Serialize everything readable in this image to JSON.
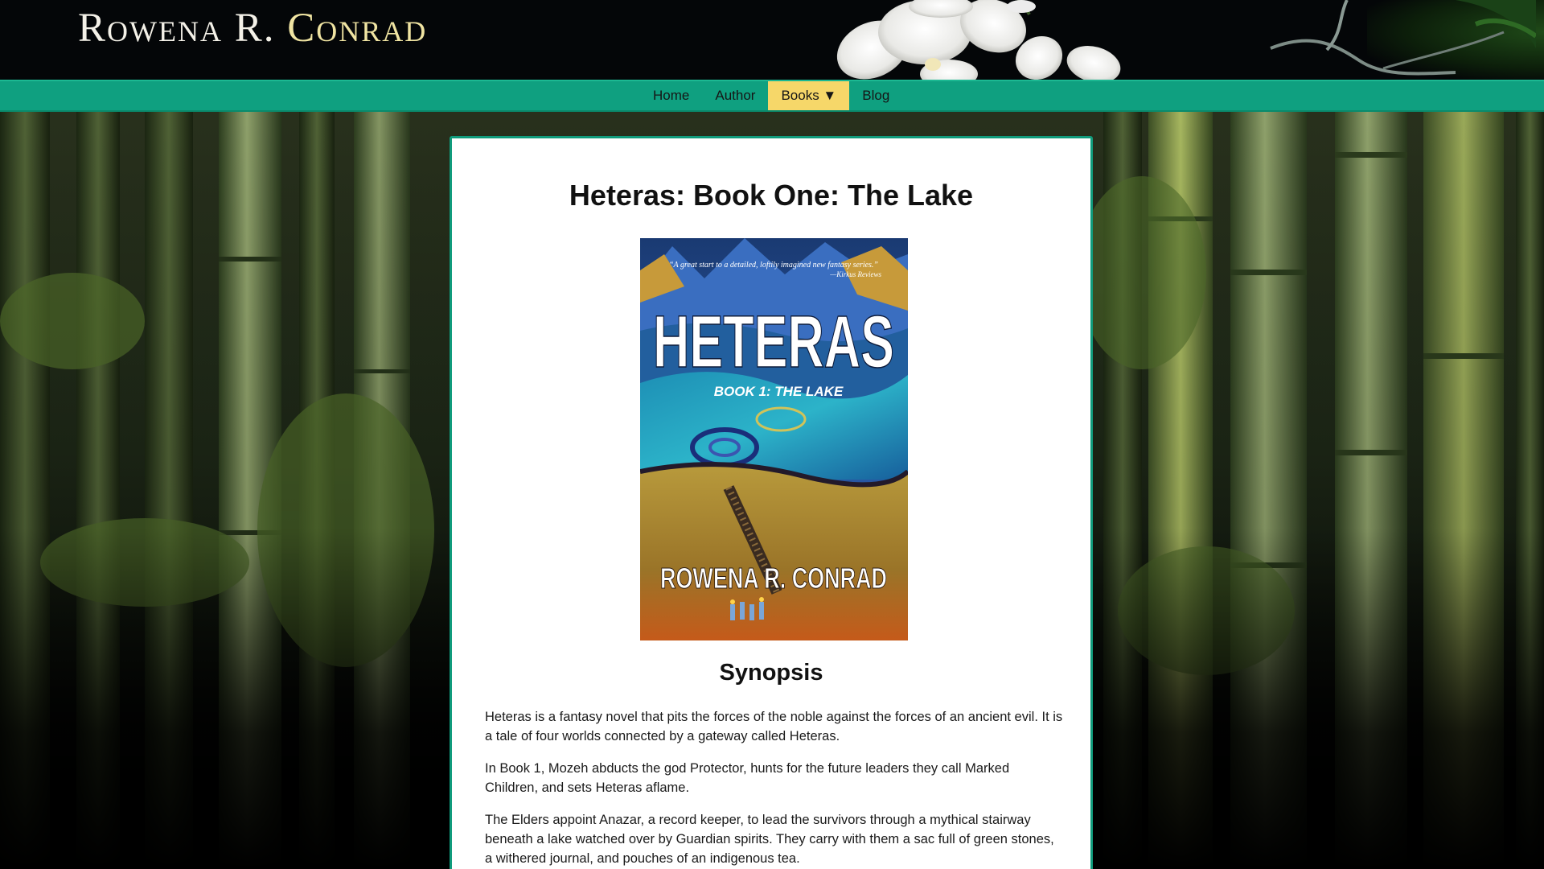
{
  "header": {
    "title_first": "Rowena R.",
    "title_last": "Conrad"
  },
  "nav": {
    "items": [
      {
        "label": "Home",
        "active": false
      },
      {
        "label": "Author",
        "active": false
      },
      {
        "label": "Books ▼",
        "active": true
      },
      {
        "label": "Blog",
        "active": false
      }
    ]
  },
  "page": {
    "title": "Heteras: Book One: The Lake",
    "cover": {
      "quote": "“A great start to a detailed, loftily imagined new fantasy series.”",
      "quote_source": "—Kirkus Reviews",
      "series": "HETERAS",
      "subtitle": "BOOK 1: THE LAKE",
      "author": "ROWENA R. CONRAD"
    },
    "synopsis_heading": "Synopsis",
    "paragraphs": [
      "Heteras is a fantasy novel that pits the forces of the noble against the forces of an ancient evil. It is a tale of four worlds connected by a gateway called Heteras.",
      "In Book 1, Mozeh abducts the god Protector, hunts for the future leaders they call Marked Children, and sets Heteras aflame.",
      "The Elders appoint Anazar, a record keeper, to lead the survivors through a mythical stairway beneath a lake watched over by Guardian spirits. They carry with them a sac full of green stones, a withered journal, and pouches of an indigenous tea."
    ]
  },
  "colors": {
    "nav_bg": "#0fa080",
    "nav_active": "#f6d769",
    "title_accent": "#f0e4a2",
    "card_border": "#109b7c"
  }
}
